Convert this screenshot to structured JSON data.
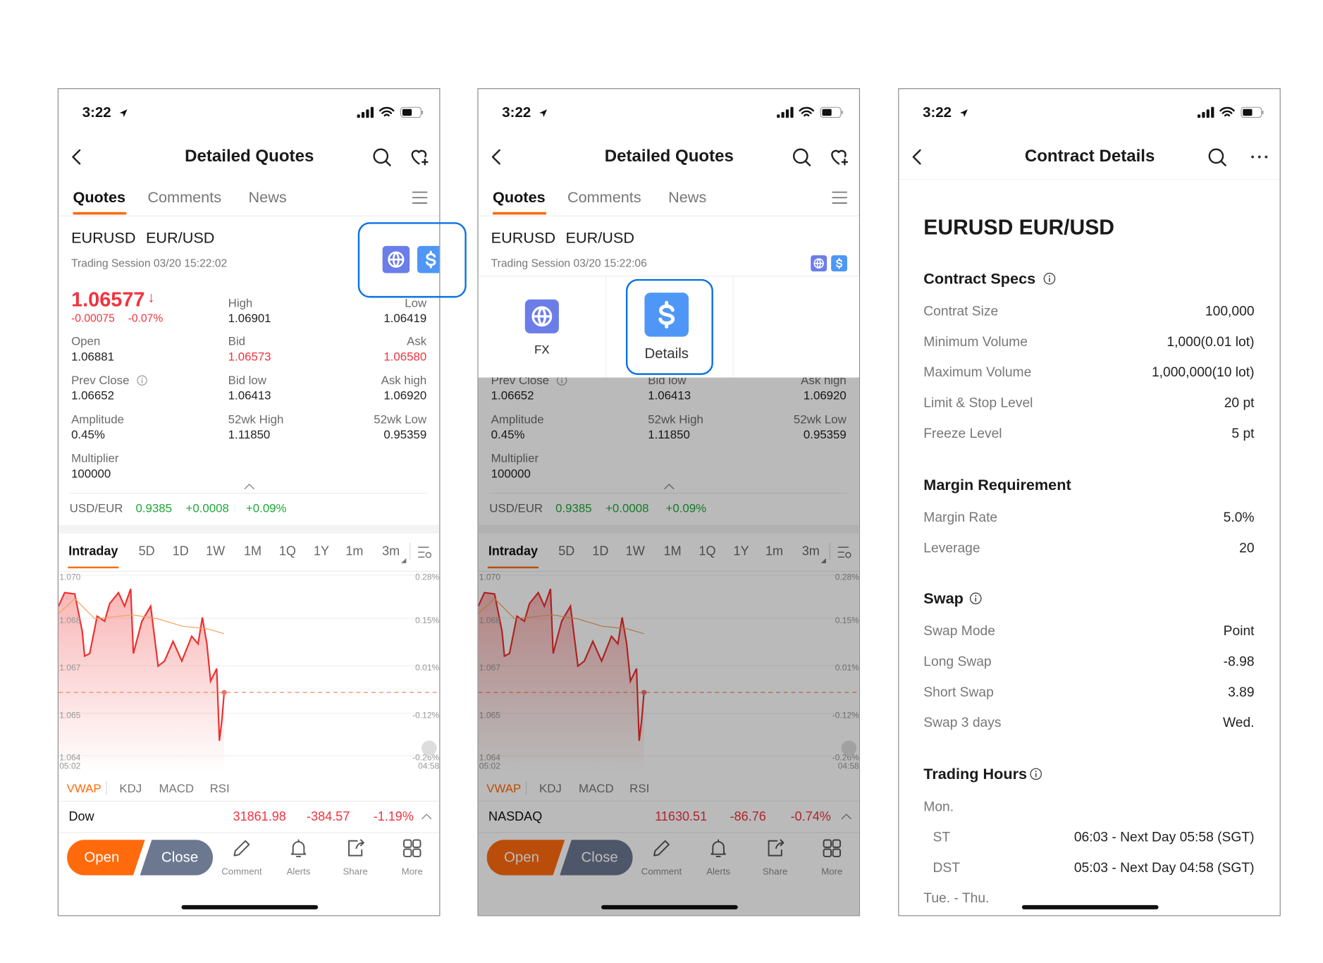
{
  "colors": {
    "accent": "#ff6a0d",
    "down": "#f0333f",
    "up": "#1fa838",
    "close_button": "#6b7890",
    "highlight": "#0a72e0",
    "fx_icon": "#6a7de8",
    "details_icon": "#4f97f7"
  },
  "status": {
    "time": "3:22"
  },
  "quote": {
    "nav_title": "Detailed Quotes",
    "tabs": [
      "Quotes",
      "Comments",
      "News"
    ],
    "symbol": "EURUSD",
    "name": "EUR/USD",
    "price": "1.06577",
    "change": "-0.00075",
    "change_pct": "-0.07%",
    "stats": [
      {
        "label": "High",
        "value": "1.06901"
      },
      {
        "label": "Low",
        "value": "1.06419"
      },
      {
        "label": "Open",
        "value": "1.06881"
      },
      {
        "label": "Bid",
        "value": "1.06573"
      },
      {
        "label": "Ask",
        "value": "1.06580"
      },
      {
        "label": "Prev Close",
        "value": "1.06652"
      },
      {
        "label": "Bid low",
        "value": "1.06413"
      },
      {
        "label": "Ask high",
        "value": "1.06920"
      },
      {
        "label": "Amplitude",
        "value": "0.45%"
      },
      {
        "label": "52wk High",
        "value": "1.11850"
      },
      {
        "label": "52wk Low",
        "value": "0.95359"
      },
      {
        "label": "Multiplier",
        "value": "100000"
      }
    ],
    "related": {
      "name": "USD/EUR",
      "value": "0.9385",
      "change": "+0.0008",
      "pct": "+0.09%"
    },
    "periods": [
      "Intraday",
      "5D",
      "1D",
      "1W",
      "1M",
      "1Q",
      "1Y",
      "1m",
      "3m"
    ],
    "indicators": [
      "VWAP",
      "KDJ",
      "MACD",
      "RSI"
    ],
    "toolbar": {
      "open": "Open",
      "close": "Close",
      "items": [
        "Comment",
        "Alerts",
        "Share",
        "More"
      ]
    }
  },
  "screen1": {
    "session": "Trading Session 03/20 15:22:02",
    "index": {
      "name": "Dow",
      "value": "31861.98",
      "change": "-384.57",
      "pct": "-1.19%"
    }
  },
  "screen2": {
    "session": "Trading Session 03/20 15:22:06",
    "index": {
      "name": "NASDAQ",
      "value": "11630.51",
      "change": "-86.76",
      "pct": "-0.74%"
    },
    "popup": {
      "items": [
        "FX",
        "Details"
      ]
    }
  },
  "screen3": {
    "nav_title": "Contract Details",
    "heading": "EURUSD EUR/USD",
    "sections": [
      {
        "title": "Contract Specs",
        "info": true,
        "rows": [
          [
            "Contrat Size",
            "100,000"
          ],
          [
            "Minimum Volume",
            "1,000(0.01 lot)"
          ],
          [
            "Maximum Volume",
            "1,000,000(10 lot)"
          ],
          [
            "Limit & Stop Level",
            "20 pt"
          ],
          [
            "Freeze Level",
            "5 pt"
          ]
        ]
      },
      {
        "title": "Margin Requirement",
        "info": false,
        "rows": [
          [
            "Margin Rate",
            "5.0%"
          ],
          [
            "Leverage",
            "20"
          ]
        ]
      },
      {
        "title": "Swap",
        "info": true,
        "rows": [
          [
            "Swap Mode",
            "Point"
          ],
          [
            "Long Swap",
            "-8.98"
          ],
          [
            "Short Swap",
            "3.89"
          ],
          [
            "Swap 3 days",
            "Wed."
          ]
        ]
      },
      {
        "title": "Trading Hours",
        "info": true,
        "rows": [
          [
            "Mon.",
            ""
          ],
          [
            "ST",
            "06:03 - Next Day 05:58 (SGT)"
          ],
          [
            "DST",
            "05:03 - Next Day 04:58 (SGT)"
          ],
          [
            "Tue. - Thu.",
            ""
          ]
        ]
      }
    ]
  },
  "chart_data": {
    "type": "line",
    "x_ticks": [
      "05:02",
      "04:58"
    ],
    "y_ticks_left": [
      "1.070",
      "1.068",
      "1.067",
      "1.065",
      "1.064"
    ],
    "y_ticks_right": [
      "0.28%",
      "0.15%",
      "0.01%",
      "-0.12%",
      "-0.26%"
    ],
    "ylim": [
      1.06375,
      1.06951
    ],
    "last_price": 1.06577,
    "grid": true,
    "series": [
      {
        "points": [
          [
            "05:02",
            1.06852
          ],
          [
            "05:25",
            1.06895
          ],
          [
            "06:03",
            1.06891
          ],
          [
            "06:31",
            1.06772
          ],
          [
            "06:40",
            1.06693
          ],
          [
            "06:59",
            1.06701
          ],
          [
            "07:27",
            1.0682
          ],
          [
            "07:55",
            1.06804
          ],
          [
            "08:14",
            1.0686
          ],
          [
            "08:47",
            1.06895
          ],
          [
            "09:10",
            1.06852
          ],
          [
            "09:33",
            1.06907
          ],
          [
            "09:43",
            1.06701
          ],
          [
            "10:15",
            1.06804
          ],
          [
            "10:48",
            1.06852
          ],
          [
            "11:16",
            1.06661
          ],
          [
            "11:40",
            1.06677
          ],
          [
            "12:12",
            1.0674
          ],
          [
            "12:45",
            1.06677
          ],
          [
            "13:22",
            1.06756
          ],
          [
            "13:46",
            1.06732
          ],
          [
            "14:02",
            1.06816
          ],
          [
            "14:19",
            1.06732
          ],
          [
            "14:33",
            1.06613
          ],
          [
            "14:56",
            1.06653
          ],
          [
            "15:06",
            1.06423
          ],
          [
            "15:15",
            1.06486
          ],
          [
            "15:24",
            1.06577
          ]
        ],
        "color": "#ee2f2f"
      },
      {
        "name": "VWAP",
        "points": [
          [
            "05:02",
            1.06828
          ],
          [
            "06:03",
            1.06876
          ],
          [
            "07:18",
            1.06812
          ],
          [
            "08:52",
            1.0682
          ],
          [
            "09:40",
            1.06824
          ],
          [
            "11:13",
            1.06812
          ],
          [
            "12:47",
            1.06788
          ],
          [
            "14:20",
            1.0678
          ],
          [
            "15:24",
            1.06764
          ]
        ],
        "color": "#f5a25a"
      }
    ]
  }
}
